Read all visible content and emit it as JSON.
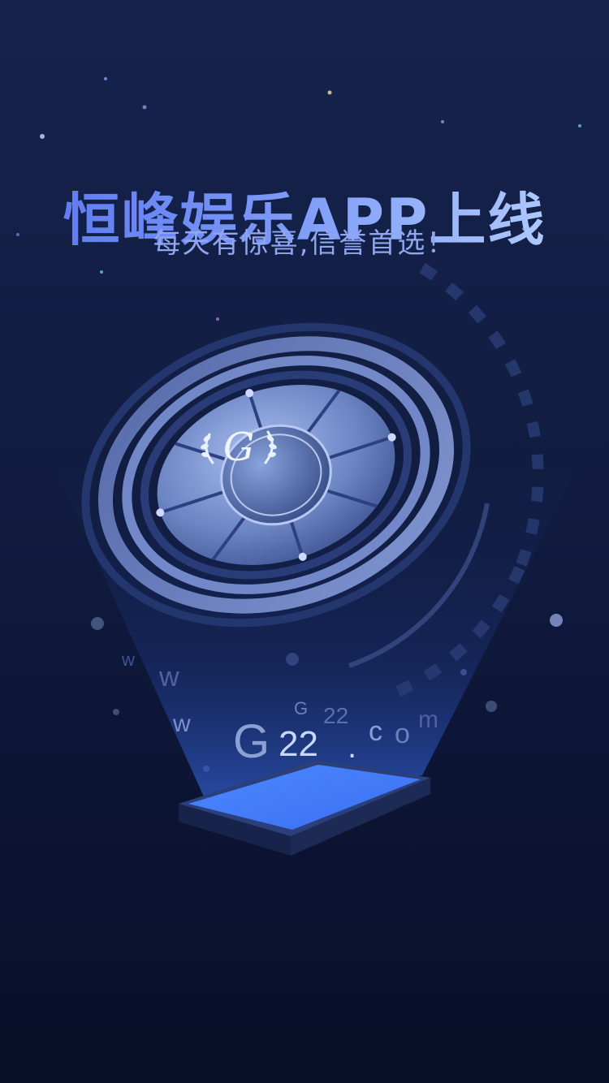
{
  "splash": {
    "title": "恒峰娱乐APP上线",
    "subtitle": "每天有惊喜,信誉首选！"
  },
  "hologram": {
    "logo_letter": "G",
    "url_parts": {
      "w1": "w",
      "w2": "w",
      "w3": "w",
      "g_big": "G",
      "num_big": "22",
      "g_small": "G",
      "num_small": "22",
      "dot": ".",
      "c": "c",
      "o": "o",
      "m": "m"
    }
  },
  "icons": {
    "emblem": "laurel-g-emblem-icon",
    "phone": "phone-projector-icon"
  },
  "colors": {
    "background_top": "#15234d",
    "background_bottom": "#090f28",
    "title_start": "#5a74f0",
    "title_end": "#b9d3ff",
    "subtitle": "#90a6f0",
    "glow": "#4f86ff"
  }
}
